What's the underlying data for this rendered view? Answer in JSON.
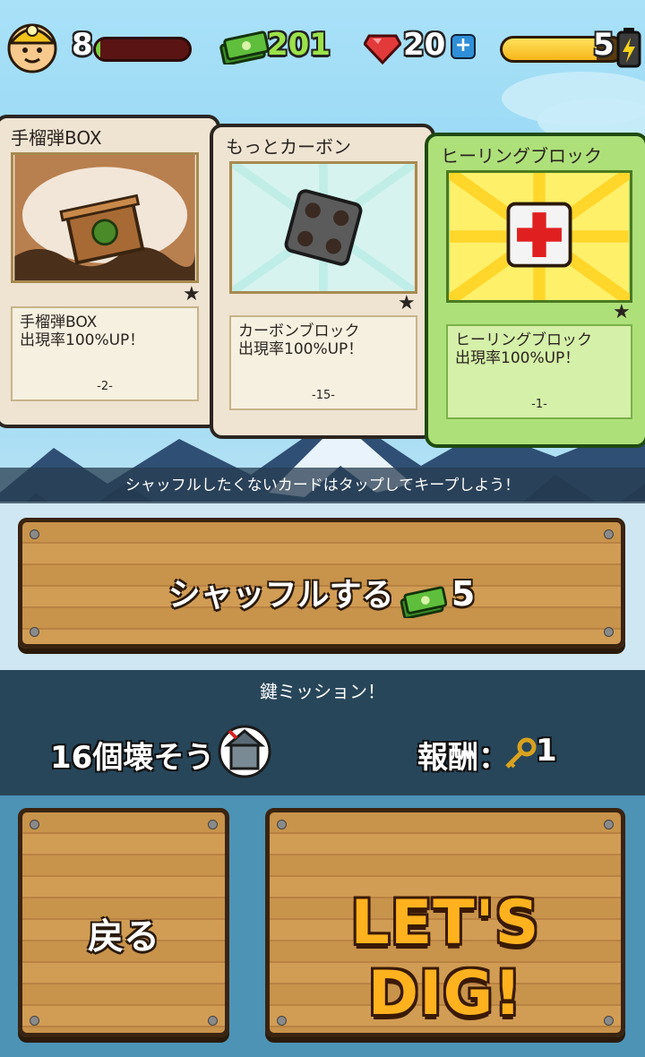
{
  "hud": {
    "level": "8",
    "level_progress": 0.05,
    "money": "201",
    "gems": "20",
    "gems_plus": "+",
    "energy": "5",
    "energy_progress": 0.78
  },
  "cards": [
    {
      "title": "手榴弾BOX",
      "desc_line1": "手榴弾BOX",
      "desc_line2": "出現率100%UP！",
      "number": "-2-",
      "star": "★",
      "kept": false,
      "icon": "grenade-crate-icon"
    },
    {
      "title": "もっとカーボン",
      "desc_line1": "カーボンブロック",
      "desc_line2": "出現率100%UP！",
      "number": "-15-",
      "star": "★",
      "kept": false,
      "icon": "carbon-block-icon"
    },
    {
      "title": "ヒーリングブロック",
      "desc_line1": "ヒーリングブロック",
      "desc_line2": "出現率100%UP！",
      "number": "-1-",
      "star": "★",
      "kept": true,
      "icon": "healing-block-icon"
    }
  ],
  "hint": "シャッフルしたくないカードはタップしてキープしよう！",
  "shuffle": {
    "label": "シャッフルする",
    "cost": "5"
  },
  "mission": {
    "title": "鍵ミッション！",
    "task": "16個壊そう",
    "reward_label": "報酬：",
    "reward_value": "1"
  },
  "buttons": {
    "back": "戻る",
    "dig": "LET'S DIG!"
  },
  "colors": {
    "green_card": "#aee07a",
    "wood": "#c8934b",
    "money_green": "#9be24a",
    "dig_orange": "#ffb21e"
  }
}
